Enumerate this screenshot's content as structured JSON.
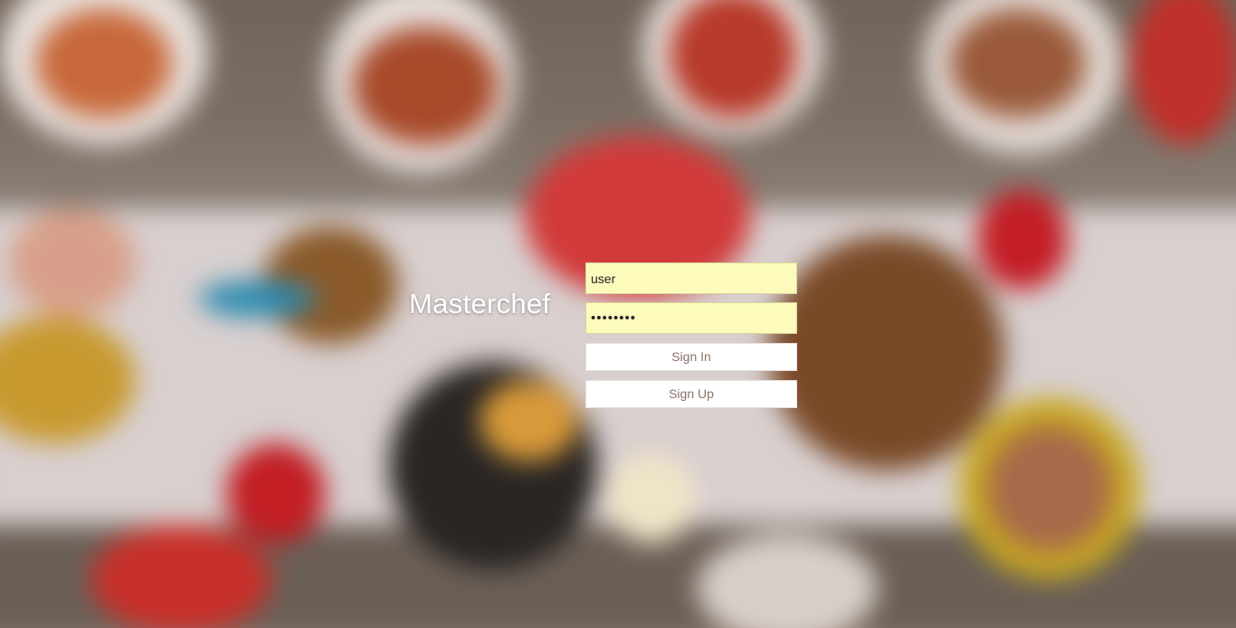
{
  "brand": {
    "title": "Masterchef"
  },
  "form": {
    "username_value": "user",
    "password_value": "password",
    "signin_label": "Sign In",
    "signup_label": "Sign Up"
  },
  "colors": {
    "input_background": "#fcfbbb",
    "button_text": "#8a7468",
    "brand_text": "#ffffff"
  }
}
